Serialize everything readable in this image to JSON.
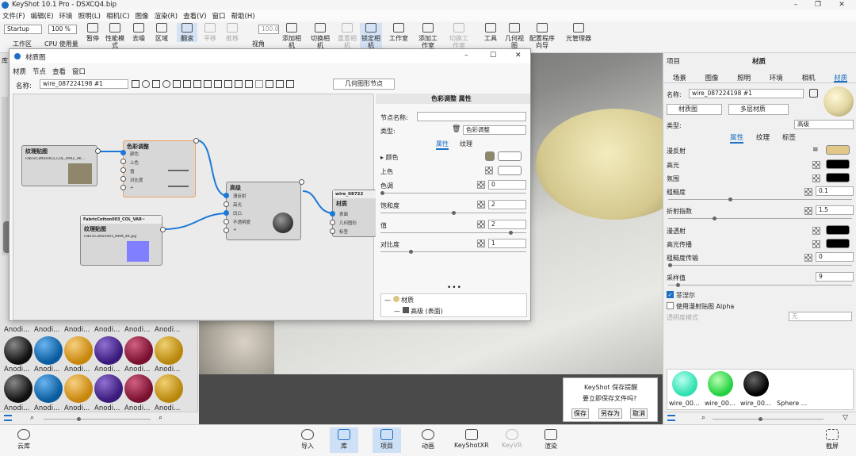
{
  "app": {
    "title": "KeyShot 10.1 Pro - DSXCQ4.bip"
  },
  "menu": [
    "文件(F)",
    "编辑(E)",
    "环境",
    "照明(L)",
    "相机(C)",
    "图像",
    "渲染(R)",
    "查看(V)",
    "窗口",
    "帮助(H)"
  ],
  "ribbon": {
    "workspace_select": "Startup",
    "zoom_select": "100 %",
    "zoom_value": "100.0",
    "items": {
      "workspace": "工作区",
      "cpu": "CPU 使用量",
      "pause": "暂停",
      "perf": "性能模式",
      "denoise": "去噪",
      "region": "区域",
      "flip": "翻滚",
      "pan": "平移",
      "push": "推移",
      "view": "视角",
      "add_camera": "添加相机",
      "switch_camera": "切换相机",
      "reset_camera": "重置相机",
      "lock_camera": "锁定相机",
      "studio": "工作室",
      "add_studio": "添加工作室",
      "switch_studio": "切换工作室",
      "tools": "工具",
      "geometry": "几何视图",
      "config": "配置程序向导",
      "light_manager": "光管理器"
    }
  },
  "left_panel": {
    "tab": "库",
    "row_labels_top": [
      "Anodi...",
      "Anodi...",
      "Anodi...",
      "Anodi...",
      "Anodi...",
      "Anodi..."
    ],
    "row_labels_mid": [
      "Anodi...",
      "Anodi...",
      "Anodi...",
      "Anodi...",
      "Anodi...",
      "Anodi..."
    ],
    "row_labels_bot": [
      "Anodi...",
      "Anodi...",
      "Anodi...",
      "Anodi...",
      "Anodi...",
      "Anodi..."
    ],
    "colors": [
      "#101010",
      "#0a5c9e",
      "#c8870c",
      "#3a1a7a",
      "#7a1030",
      "#b8880e"
    ]
  },
  "material_window": {
    "title": "材质图",
    "menu": [
      "材质",
      "节点",
      "查看",
      "窗口"
    ],
    "name_label": "名称:",
    "name_value": "wire_087224198 #1",
    "geometry_node_btn": "几何图形节点",
    "nodes": {
      "texture1_title": "纹理贴图",
      "texture1_file": "FabricCotton003_COL_VAR2_4K...",
      "color_adjust_title": "色彩调整",
      "color_adjust_ports": [
        "颜色",
        "上色",
        "值",
        "对比度",
        "+"
      ],
      "advanced_title": "高级",
      "advanced_ports": [
        "漫反射",
        "高光",
        "凹凸",
        "不透明度",
        "+"
      ],
      "texture2_header": "FabricCotton003_COL_VAR~",
      "texture2_title": "纹理贴图",
      "texture2_file": "FabricCotton003_NRM_4K.jpg",
      "material_header": "wire_08722",
      "material_title": "材质",
      "material_ports": [
        "表面",
        "几何图形",
        "标签"
      ]
    },
    "props": {
      "header": "色彩调整 属性",
      "node_name_label": "节点名称:",
      "type_label": "类型:",
      "type_value": "色彩调整",
      "tab_props": "属性",
      "tab_texture": "纹理",
      "color_label": "颜色",
      "tint_label": "上色",
      "hue_label": "色调",
      "hue_value": "0",
      "saturation_label": "饱和度",
      "saturation_value": "2",
      "value_label": "值",
      "value_value": "2",
      "contrast_label": "对比度",
      "contrast_value": "1",
      "tree_root": "材质",
      "tree_child": "高级 (表面)"
    }
  },
  "right_panel": {
    "project_label": "项目",
    "material_label": "材质",
    "tabs": [
      "场景",
      "图像",
      "照明",
      "环境",
      "相机",
      "材质"
    ],
    "name_label": "名称:",
    "name_value": "wire_087224198 #1",
    "mat_graph_btn": "材质图",
    "multi_mat_btn": "多层材质",
    "type_label": "类型:",
    "type_value": "高级",
    "sub_tabs": [
      "属性",
      "纹理",
      "标签"
    ],
    "rows": {
      "diffuse": "漫反射",
      "specular": "高光",
      "ambient": "氛围",
      "roughness": "粗糙度",
      "roughness_value": "0.1",
      "ior": "折射指数",
      "ior_value": "1.5",
      "transmission": "漫透射",
      "spec_trans": "高光传播",
      "rough_trans": "粗糙度传输",
      "rough_trans_value": "0",
      "samples": "采样值",
      "samples_value": "9",
      "fresnel": "菲涅尔",
      "use_diffuse_alpha": "使用漫射贴图 Alpha",
      "transparency_mode": "透明度模式",
      "transparency_value": "无"
    },
    "diffuse_color": "#e2c888",
    "materials": [
      "wire_00...",
      "wire_00...",
      "wire_00...",
      "Sphere ..."
    ]
  },
  "save_dialog": {
    "title": "KeyShot 保存提醒",
    "question": "要立即保存文件吗?",
    "save": "保存",
    "save_as": "另存为",
    "cancel": "取消"
  },
  "bottom_bar": {
    "cloud": "云库",
    "import": "导入",
    "library": "库",
    "project": "项目",
    "animation": "动画",
    "keyshotxr": "KeyShotXR",
    "keyve": "KeyVR",
    "render": "渲染",
    "screenshot": "截屏"
  }
}
